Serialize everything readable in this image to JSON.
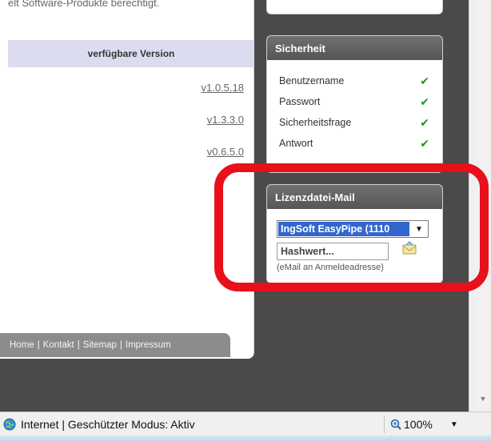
{
  "main": {
    "intro_text": "elt Software-Produkte berechtigt.",
    "version_header": "verfügbare Version",
    "versions": [
      "v1.0.5.18",
      "v1.3.3.0",
      "v0.6.5.0"
    ],
    "footer_links": [
      "Home",
      "Kontakt",
      "Sitemap",
      "Impressum"
    ]
  },
  "security": {
    "title": "Sicherheit",
    "items": [
      {
        "label": "Benutzername"
      },
      {
        "label": "Passwort"
      },
      {
        "label": "Sicherheitsfrage"
      },
      {
        "label": "Antwort"
      }
    ]
  },
  "license": {
    "title": "Lizenzdatei-Mail",
    "selected_product": "IngSoft EasyPipe (1110",
    "hash_placeholder": "Hashwert...",
    "hint": "(eMail an Anmeldeadresse)"
  },
  "status_bar": {
    "zone_text": "Internet | Geschützter Modus: Aktiv",
    "zoom": "100%"
  },
  "colors": {
    "highlight": "#e8101a",
    "check": "#1d9a1d",
    "selection": "#3366cc"
  }
}
